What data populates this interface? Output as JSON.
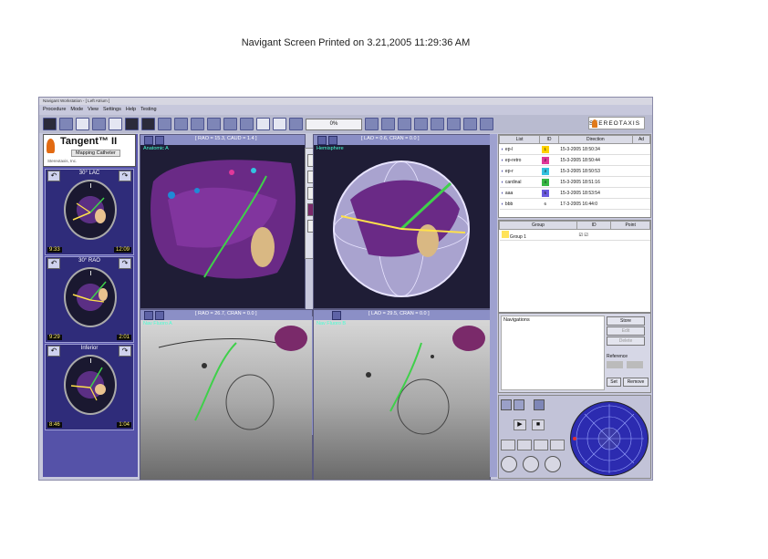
{
  "print_header": "Navigant Screen Printed on 3.21,2005 11:29:36 AM",
  "window": {
    "title": "Navigant Workstation - [ Left Atrium ]"
  },
  "menu": [
    "Procedure",
    "Mode",
    "View",
    "Settings",
    "Help",
    "Testing"
  ],
  "toolbar": {
    "progress": "0%",
    "logo": "STEREOTAXIS"
  },
  "catheter": {
    "name": "Tangent™ II",
    "type": "Mapping Catheter",
    "maker": "Stereotaxis, Inc."
  },
  "views": [
    {
      "title": "30° LAC",
      "left": "9:33",
      "right": "12:09"
    },
    {
      "title": "30° RAO",
      "left": "9:29",
      "right": "2:01"
    },
    {
      "title": "Inferior",
      "left": "8:46",
      "right": "1:04"
    }
  ],
  "panes": {
    "anatomic": {
      "label": "Anatomic A",
      "params": "[ RAO = 15.3, CAUD = 1.4 ]"
    },
    "hemisphere": {
      "label": "Hemisphere",
      "params": "[ LAO = 0.6, CRAN = 0.0 ]"
    },
    "fluoro_a": {
      "label": "Nav Fluoro A",
      "params": "[ RAO = 26.7, CRAN = 0.0 ]"
    },
    "fluoro_b": {
      "label": "Nav Fluoro B",
      "params": "[ LAO = 29.5, CRAN = 0.0 ]"
    }
  },
  "list_panel": {
    "headers": [
      "List",
      "ID",
      "Direction",
      "Ad"
    ],
    "rows": [
      {
        "name": "ep-l",
        "id": "1",
        "color": "#ffd200",
        "direction": "15-3-2005 18:50:34"
      },
      {
        "name": "ep-retro",
        "id": "2",
        "color": "#e0389a",
        "direction": "15-3-2005 18:50:44"
      },
      {
        "name": "ep-r",
        "id": "3",
        "color": "#33c3e0",
        "direction": "15-3-2005 18:50:53"
      },
      {
        "name": "cardinal",
        "id": "4",
        "color": "#36b845",
        "direction": "15-3-2005 18:51:16"
      },
      {
        "name": "aaa",
        "id": "5",
        "color": "#6a5adf",
        "direction": "15-3-2005 18:53:54"
      },
      {
        "name": "bbb",
        "id": "6",
        "color": "#ffffff",
        "direction": "17-3-2005 16:44:0"
      }
    ]
  },
  "group_panel": {
    "headers": [
      "Group",
      "ID",
      "Point"
    ],
    "rows": [
      {
        "name": "Group 1"
      }
    ]
  },
  "navigations_panel": {
    "title": "Navigations",
    "buttons": {
      "store": "Store",
      "edit": "Edit",
      "delete": "Delete",
      "set": "Set",
      "remove": "Remove"
    },
    "reference_label": "Reference"
  },
  "colors": {
    "accent": "#4a4aa8",
    "brand": "#e26a12",
    "overlay": "#4affd3",
    "catheter": "#3fd04a"
  }
}
